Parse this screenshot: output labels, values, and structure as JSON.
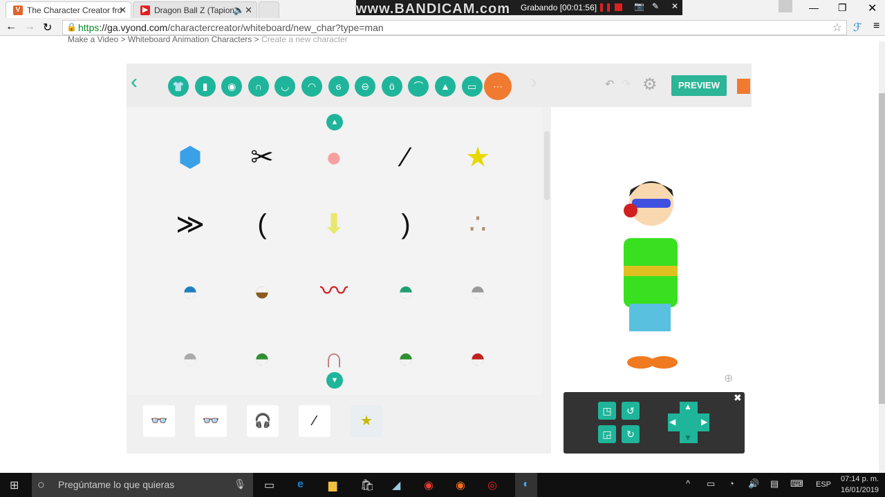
{
  "browser": {
    "tabs": [
      {
        "title": "The Character Creator fro",
        "favicon": "V",
        "active": true
      },
      {
        "title": "Dragon Ball Z (Tapion's",
        "favicon": "youtube",
        "audio": true
      }
    ],
    "url_scheme": "https",
    "url_host": "://ga.vyond.com",
    "url_path": "/charactercreator/whiteboard/new_char?type=man"
  },
  "recorder": {
    "watermark": "www.BANDICAM.com",
    "status": "Grabando [00:01:56]"
  },
  "breadcrumb": {
    "items": [
      "Make a Video",
      "Whiteboard Animation Characters",
      "Create a new character"
    ],
    "sep": ">"
  },
  "toolbar": {
    "categories": [
      {
        "icon": "shirt-icon",
        "g": "👕"
      },
      {
        "icon": "pants-icon",
        "g": "▮"
      },
      {
        "icon": "face-shape-icon",
        "g": "◉"
      },
      {
        "icon": "hair-icon",
        "g": "∩"
      },
      {
        "icon": "beard-icon",
        "g": "◡"
      },
      {
        "icon": "mouth-icon",
        "g": "◠"
      },
      {
        "icon": "ear-icon",
        "g": "ϭ"
      },
      {
        "icon": "mustache-icon",
        "g": "⊖"
      },
      {
        "icon": "eye-icon",
        "g": "ö"
      },
      {
        "icon": "eyebrows-icon",
        "g": "⌒"
      },
      {
        "icon": "nose-icon",
        "g": "▲"
      },
      {
        "icon": "glasses-icon",
        "g": "▭"
      },
      {
        "icon": "accessories-icon",
        "g": "⋯",
        "active": true
      }
    ],
    "preview_label": "PREVIEW",
    "accent": "#1fb59a",
    "active_color": "#f07a30"
  },
  "grid": {
    "items": [
      {
        "name": "gem",
        "g": "⬢",
        "c": "#3aa0e8"
      },
      {
        "name": "stitches",
        "g": "✂",
        "c": "#111"
      },
      {
        "name": "blush",
        "g": "●",
        "c": "#f7a0a0"
      },
      {
        "name": "scar",
        "g": "⁄",
        "c": "#111"
      },
      {
        "name": "star",
        "g": "★",
        "c": "#e8d800"
      },
      {
        "name": "stripes",
        "g": "≫",
        "c": "#111"
      },
      {
        "name": "curve",
        "g": "(",
        "c": "#111"
      },
      {
        "name": "tie",
        "g": "⬇",
        "c": "#e8e870"
      },
      {
        "name": "hook",
        "g": ")",
        "c": "#111"
      },
      {
        "name": "freckles",
        "g": "∴",
        "c": "#b09070"
      },
      {
        "name": "blue-cap",
        "g": "◓",
        "c": "#1f7fc0"
      },
      {
        "name": "cowboy-hat",
        "g": "◒",
        "c": "#8a5a20"
      },
      {
        "name": "headband",
        "g": "〰",
        "c": "#d02020"
      },
      {
        "name": "green-cap",
        "g": "◓",
        "c": "#1fa070"
      },
      {
        "name": "trapper-hat",
        "g": "◓",
        "c": "#999"
      },
      {
        "name": "beanie",
        "g": "◓",
        "c": "#aaa"
      },
      {
        "name": "pompom-hat",
        "g": "◓",
        "c": "#2f8f2f"
      },
      {
        "name": "earmuffs",
        "g": "∩",
        "c": "#c08080"
      },
      {
        "name": "elf-hat",
        "g": "◓",
        "c": "#2f8f2f"
      },
      {
        "name": "reindeer-hat",
        "g": "◓",
        "c": "#c02020"
      }
    ]
  },
  "tray": {
    "items": [
      {
        "name": "sunglasses",
        "g": "👓"
      },
      {
        "name": "sunglasses",
        "g": "👓"
      },
      {
        "name": "headset",
        "g": "🎧"
      },
      {
        "name": "scar",
        "g": "⁄"
      },
      {
        "name": "star",
        "g": "★"
      }
    ]
  },
  "taskbar": {
    "search_placeholder": "Pregúntame lo que quieras",
    "lang": "ESP",
    "time": "07:14 p. m.",
    "date": "16/01/2019"
  }
}
